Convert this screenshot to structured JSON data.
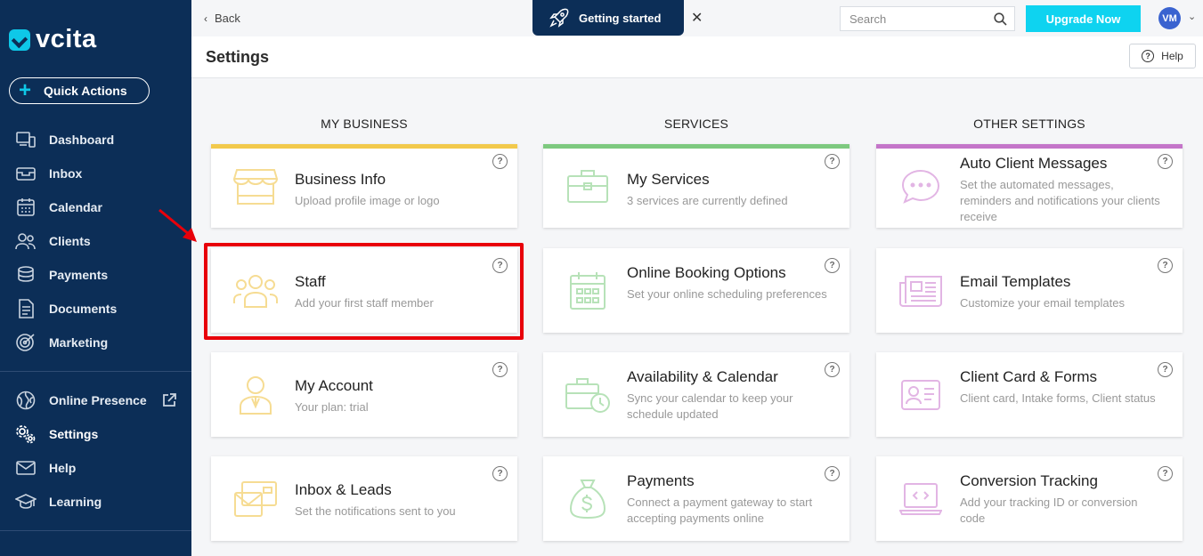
{
  "brand": {
    "name": "vcita",
    "accent": "#0ec8e8",
    "sidebar_bg": "#0c2e57"
  },
  "quick_actions": {
    "label": "Quick Actions"
  },
  "nav_primary": [
    {
      "label": "Dashboard",
      "icon": "dashboard-icon"
    },
    {
      "label": "Inbox",
      "icon": "inbox-icon"
    },
    {
      "label": "Calendar",
      "icon": "calendar-icon"
    },
    {
      "label": "Clients",
      "icon": "clients-icon"
    },
    {
      "label": "Payments",
      "icon": "payments-icon"
    },
    {
      "label": "Documents",
      "icon": "documents-icon"
    },
    {
      "label": "Marketing",
      "icon": "marketing-icon"
    }
  ],
  "nav_secondary": [
    {
      "label": "Online Presence",
      "icon": "globe-icon"
    },
    {
      "label": "Settings",
      "icon": "settings-icon"
    },
    {
      "label": "Help",
      "icon": "mail-icon"
    },
    {
      "label": "Learning",
      "icon": "graduation-cap-icon"
    }
  ],
  "topbar": {
    "back_label": "Back",
    "getting_started_label": "Getting started",
    "search_placeholder": "Search",
    "upgrade_label": "Upgrade Now",
    "avatar_initials": "VM"
  },
  "header": {
    "title": "Settings",
    "help_label": "Help"
  },
  "columns": [
    {
      "title": "MY BUSINESS",
      "color": "#f2c94c",
      "cards": [
        {
          "title": "Business Info",
          "desc": "Upload profile image or logo"
        },
        {
          "title": "Staff",
          "desc": "Add your first staff member"
        },
        {
          "title": "My Account",
          "desc": "Your plan: trial"
        },
        {
          "title": "Inbox & Leads",
          "desc": "Set the notifications sent to you"
        }
      ]
    },
    {
      "title": "SERVICES",
      "color": "#7dc97f",
      "cards": [
        {
          "title": "My Services",
          "desc": "3 services are currently defined"
        },
        {
          "title": "Online Booking Options",
          "desc": "Set your online scheduling preferences"
        },
        {
          "title": "Availability & Calendar",
          "desc": "Sync your calendar to keep your schedule updated"
        },
        {
          "title": "Payments",
          "desc": "Connect a payment gateway to start accepting payments online"
        }
      ]
    },
    {
      "title": "OTHER SETTINGS",
      "color": "#c475c9",
      "cards": [
        {
          "title": "Auto Client Messages",
          "desc": "Set the automated messages, reminders and notifications your clients receive"
        },
        {
          "title": "Email Templates",
          "desc": "Customize your email templates"
        },
        {
          "title": "Client Card & Forms",
          "desc": "Client card, Intake forms, Client status"
        },
        {
          "title": "Conversion Tracking",
          "desc": "Add your tracking ID or conversion code"
        }
      ]
    }
  ]
}
